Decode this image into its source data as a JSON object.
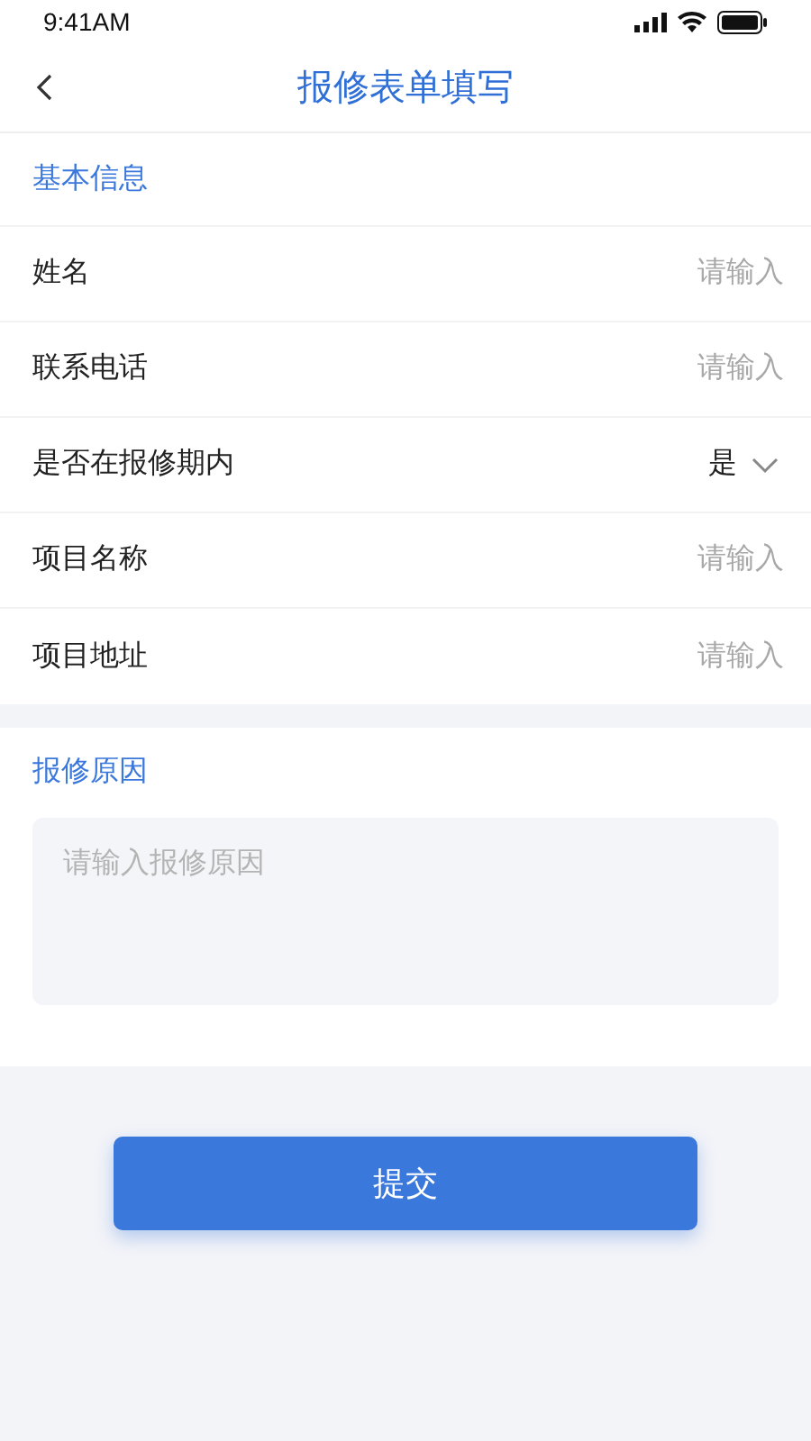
{
  "status_bar": {
    "time": "9:41AM"
  },
  "nav": {
    "title": "报修表单填写"
  },
  "basic_info": {
    "heading": "基本信息",
    "fields": [
      {
        "kind": "input",
        "label": "姓名",
        "placeholder": "请输入"
      },
      {
        "kind": "input",
        "label": "联系电话",
        "placeholder": "请输入"
      },
      {
        "kind": "select",
        "label": "是否在报修期内",
        "value": "是"
      },
      {
        "kind": "input",
        "label": "项目名称",
        "placeholder": "请输入"
      },
      {
        "kind": "input",
        "label": "项目地址",
        "placeholder": "请输入"
      }
    ]
  },
  "reason": {
    "heading": "报修原因",
    "placeholder": "请输入报修原因"
  },
  "submit_button": "提交"
}
